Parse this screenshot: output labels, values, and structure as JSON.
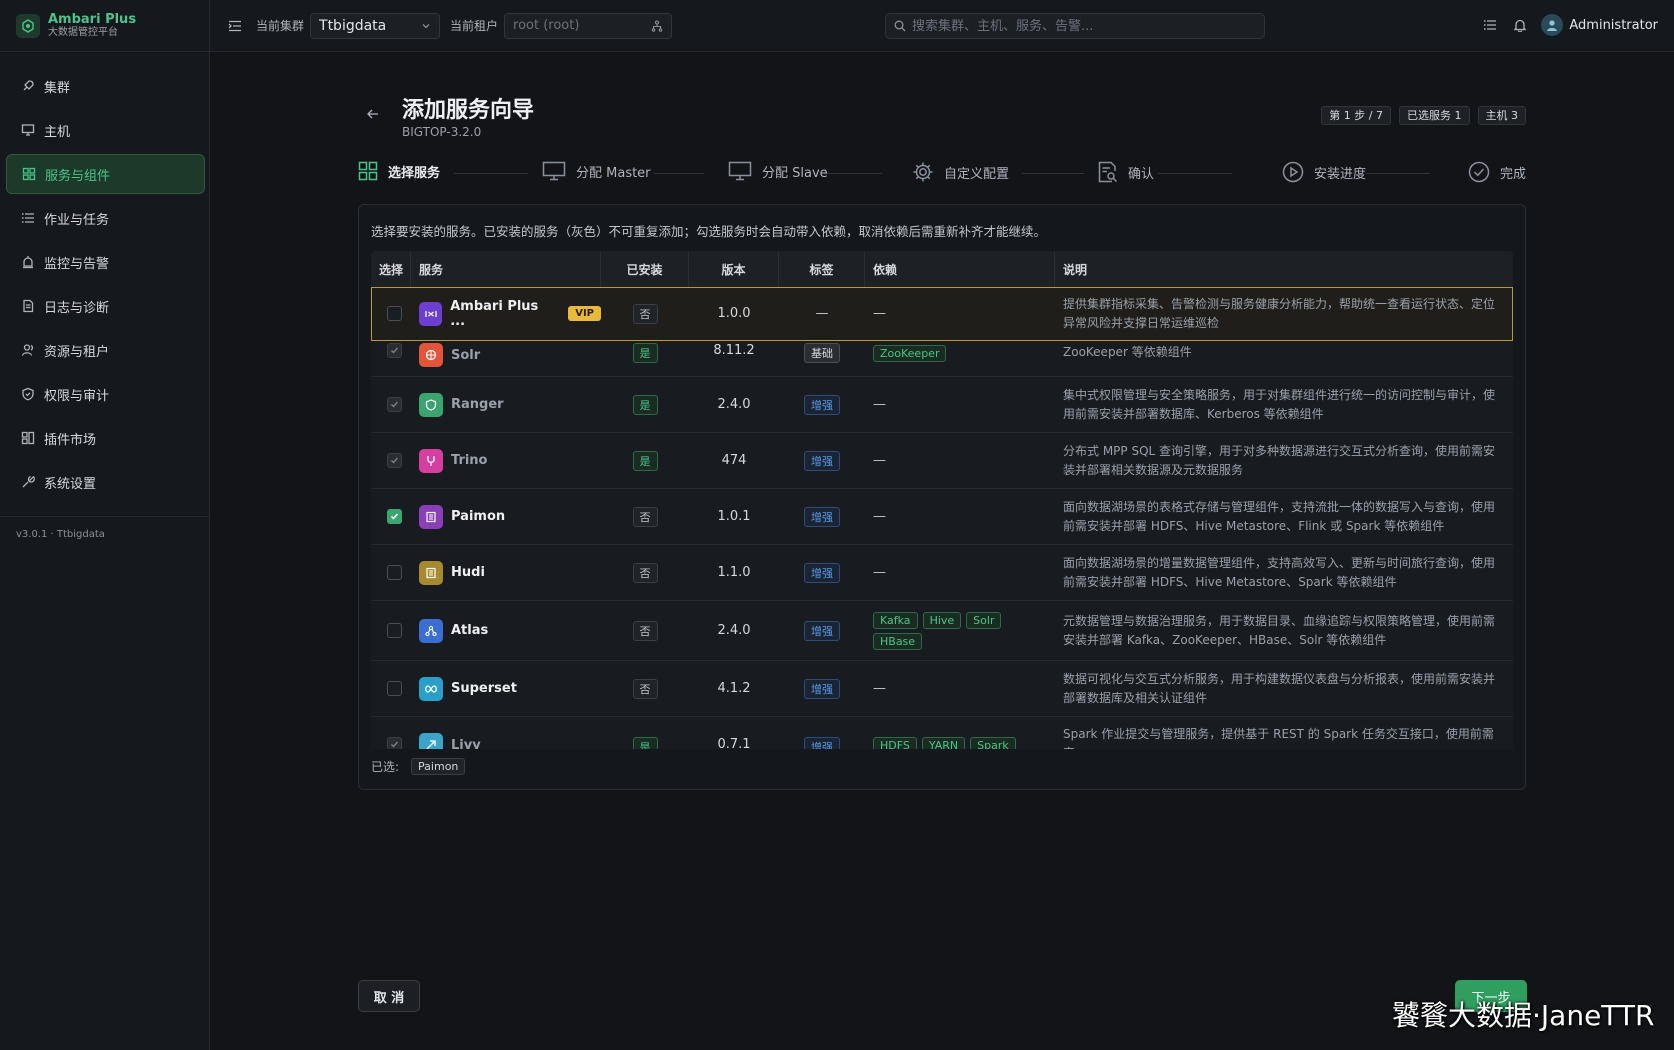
{
  "brand": {
    "title": "Ambari Plus",
    "subtitle": "大数据管控平台"
  },
  "sidebar": {
    "items": [
      {
        "label": "集群",
        "icon": "rocket-icon"
      },
      {
        "label": "主机",
        "icon": "monitor-icon"
      },
      {
        "label": "服务与组件",
        "icon": "grid-icon",
        "active": true
      },
      {
        "label": "作业与任务",
        "icon": "list-icon"
      },
      {
        "label": "监控与告警",
        "icon": "alarm-icon"
      },
      {
        "label": "日志与诊断",
        "icon": "log-icon"
      },
      {
        "label": "资源与租户",
        "icon": "users-icon"
      },
      {
        "label": "权限与审计",
        "icon": "shield-icon"
      },
      {
        "label": "插件市场",
        "icon": "plugin-icon"
      },
      {
        "label": "系统设置",
        "icon": "wrench-icon"
      }
    ],
    "version": "v3.0.1 · Ttbigdata"
  },
  "topbar": {
    "cluster_label": "当前集群",
    "cluster_value": "Ttbigdata",
    "tenant_label": "当前租户",
    "tenant_placeholder": "root (root)",
    "search_placeholder": "搜索集群、主机、服务、告警...",
    "user_name": "Administrator"
  },
  "page": {
    "title": "添加服务向导",
    "subtitle": "BIGTOP-3.2.0",
    "badges": [
      "第 1 步 / 7",
      "已选服务 1",
      "主机 3"
    ]
  },
  "steps": [
    {
      "label": "选择服务",
      "icon": "grid-icon",
      "active": true
    },
    {
      "label": "分配 Master",
      "icon": "monitor-icon"
    },
    {
      "label": "分配 Slave",
      "icon": "monitor-icon"
    },
    {
      "label": "自定义配置",
      "icon": "gear-icon"
    },
    {
      "label": "确认",
      "icon": "doc-search-icon"
    },
    {
      "label": "安装进度",
      "icon": "play-circle-icon"
    },
    {
      "label": "完成",
      "icon": "check-circle-icon"
    }
  ],
  "panel": {
    "description": "选择要安装的服务。已安装的服务（灰色）不可重复添加；勾选服务时会自动带入依赖，取消依赖后需重新补齐才能继续。",
    "columns": [
      "选择",
      "服务",
      "已安装",
      "版本",
      "标签",
      "依赖",
      "说明"
    ],
    "rows": [
      {
        "name": "Ambari Plus ...",
        "vip": "VIP",
        "installed": "否",
        "version": "1.0.0",
        "tag": "—",
        "deps": [],
        "dash": "—",
        "desc": "提供集群指标采集、告警检测与服务健康分析能力，帮助统一查看运行状态、定位异常风险并支撑日常运维巡检",
        "icon_color": "#6b3fd1",
        "state": "highlight"
      },
      {
        "name": "Solr",
        "installed": "是",
        "version": "8.11.2",
        "tag": "基础",
        "deps": [
          "ZooKeeper"
        ],
        "desc": "ZooKeeper 等依赖组件",
        "icon_color": "#e2553a",
        "state": "disabled"
      },
      {
        "name": "Ranger",
        "installed": "是",
        "version": "2.4.0",
        "tag": "增强",
        "deps": [],
        "dash": "—",
        "desc": "集中式权限管理与安全策略服务，用于对集群组件进行统一的访问控制与审计，使用前需安装并部署数据库、Kerberos 等依赖组件",
        "icon_color": "#3aa56e",
        "state": "disabled"
      },
      {
        "name": "Trino",
        "installed": "是",
        "version": "474",
        "tag": "增强",
        "deps": [],
        "dash": "—",
        "desc": "分布式 MPP SQL 查询引擎，用于对多种数据源进行交互式分析查询，使用前需安装并部署相关数据源及元数据服务",
        "icon_color": "#d63fa0",
        "state": "disabled"
      },
      {
        "name": "Paimon",
        "installed": "否",
        "version": "1.0.1",
        "tag": "增强",
        "deps": [],
        "dash": "—",
        "desc": "面向数据湖场景的表格式存储与管理组件，支持流批一体的数据写入与查询，使用前需安装并部署 HDFS、Hive Metastore、Flink 或 Spark 等依赖组件",
        "icon_color": "#8a3fb8",
        "state": "checked"
      },
      {
        "name": "Hudi",
        "installed": "否",
        "version": "1.1.0",
        "tag": "增强",
        "deps": [],
        "dash": "—",
        "desc": "面向数据湖场景的增量数据管理组件，支持高效写入、更新与时间旅行查询，使用前需安装并部署 HDFS、Hive Metastore、Spark 等依赖组件",
        "icon_color": "#a88a2e",
        "state": "normal"
      },
      {
        "name": "Atlas",
        "installed": "否",
        "version": "2.4.0",
        "tag": "增强",
        "deps": [
          "Kafka",
          "Hive",
          "Solr",
          "HBase"
        ],
        "desc": "元数据管理与数据治理服务，用于数据目录、血缘追踪与权限策略管理，使用前需安装并部署 Kafka、ZooKeeper、HBase、Solr 等依赖组件",
        "icon_color": "#3a6fd1",
        "state": "normal"
      },
      {
        "name": "Superset",
        "installed": "否",
        "version": "4.1.2",
        "tag": "增强",
        "deps": [],
        "dash": "—",
        "desc": "数据可视化与交互式分析服务，用于构建数据仪表盘与分析报表，使用前需安装并部署数据库及相关认证组件",
        "icon_color": "#2aa0c8",
        "state": "normal"
      },
      {
        "name": "Livy",
        "installed": "是",
        "version": "0.7.1",
        "tag": "增强",
        "deps": [
          "HDFS",
          "YARN",
          "Spark"
        ],
        "desc": "Spark 作业提交与管理服务，提供基于 REST 的 Spark 任务交互接口，使用前需安",
        "icon_color": "#3aa5c8",
        "state": "disabled"
      }
    ],
    "selected_label": "已选:",
    "selected_items": [
      "Paimon"
    ]
  },
  "footer": {
    "cancel_label": "取 消",
    "next_label": "下一步"
  },
  "watermark": "饕餮大数据·JaneTTR"
}
